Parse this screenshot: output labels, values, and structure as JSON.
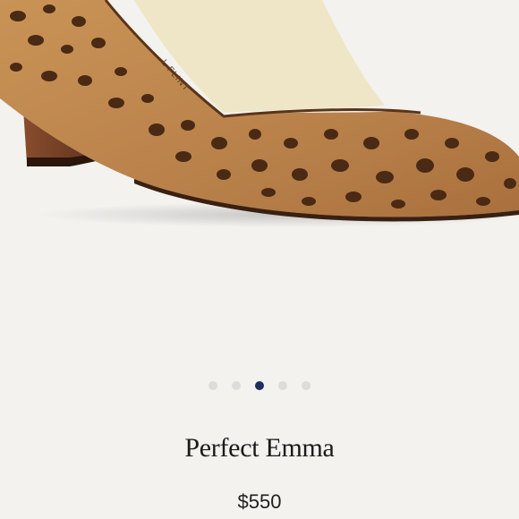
{
  "product": {
    "brand_print": "L FLINT",
    "name": "Perfect Emma",
    "price": "$550",
    "image_icon": "leopard-print-pump-image"
  },
  "carousel": {
    "total_slides": 5,
    "active_index": 2
  },
  "colors": {
    "background": "#f3f2ef",
    "dot_inactive": "#dcdcdc",
    "dot_active": "#1f2d5c",
    "leopard_base": "#c08a4e",
    "leopard_spot": "#4a2a14",
    "heel_wood": "#6b3a22",
    "insole": "#efe6c8"
  }
}
